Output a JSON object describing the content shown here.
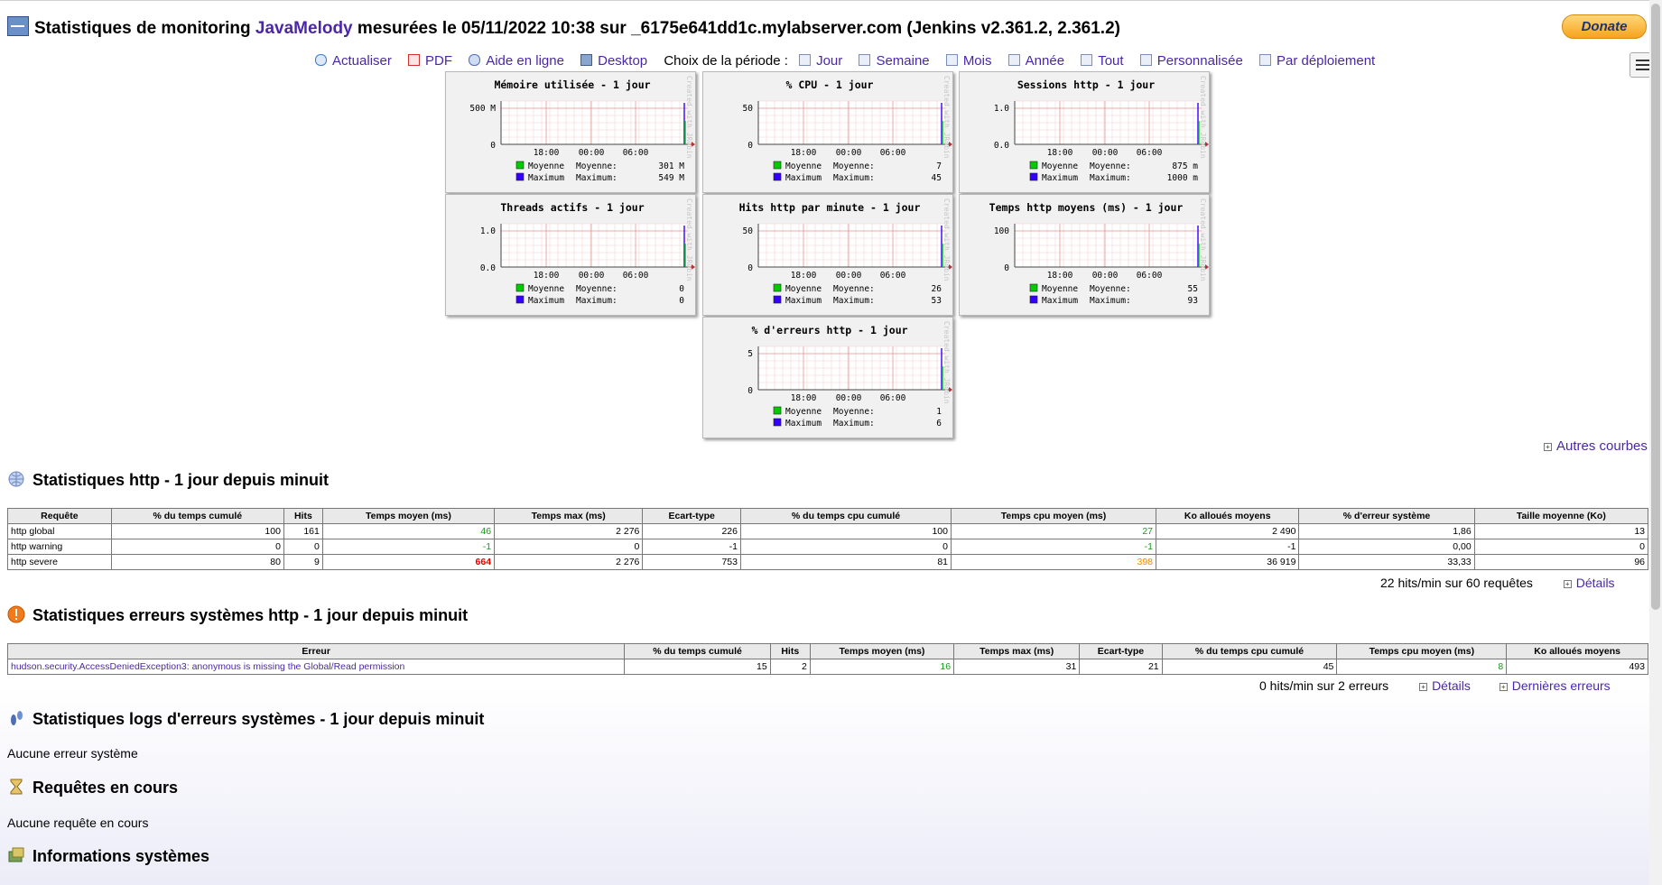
{
  "header": {
    "title_pre": "Statistiques de monitoring",
    "app_name": "JavaMelody",
    "title_post": "mesurées le 05/11/2022 10:38 sur _6175e641dd1c.mylabserver.com (Jenkins v2.361.2, 2.361.2)",
    "donate_label": "Donate"
  },
  "toolbar": {
    "refresh": "Actualiser",
    "pdf": "PDF",
    "help": "Aide en ligne",
    "desktop": "Desktop",
    "period_label": "Choix de la période :",
    "day": "Jour",
    "week": "Semaine",
    "month": "Mois",
    "year": "Année",
    "all": "Tout",
    "custom": "Personnalisée",
    "deploy": "Par déploiement"
  },
  "charts": [
    {
      "title": "Mémoire utilisée - 1 jour",
      "yticks": [
        "500 M",
        "0"
      ],
      "avg": "301 M",
      "max": "549 M"
    },
    {
      "title": "% CPU - 1 jour",
      "yticks": [
        "50",
        "0"
      ],
      "avg": "7",
      "max": "45"
    },
    {
      "title": "Sessions http - 1 jour",
      "yticks": [
        "1.0",
        "0.0"
      ],
      "avg": "875 m",
      "max": "1000 m"
    },
    {
      "title": "Threads actifs - 1 jour",
      "yticks": [
        "1.0",
        "0.0"
      ],
      "avg": "0",
      "max": "0"
    },
    {
      "title": "Hits http par minute - 1 jour",
      "yticks": [
        "50",
        "0"
      ],
      "avg": "26",
      "max": "53"
    },
    {
      "title": "Temps http moyens (ms) - 1 jour",
      "yticks": [
        "100",
        "0"
      ],
      "avg": "55",
      "max": "93"
    },
    {
      "title": "% d'erreurs http - 1 jour",
      "yticks": [
        "5",
        "0"
      ],
      "avg": "1",
      "max": "6"
    }
  ],
  "chart_common": {
    "xticks": [
      "18:00",
      "00:00",
      "06:00"
    ],
    "legend_avg": "Moyenne",
    "legend_max": "Maximum",
    "avg_label": "Moyenne:",
    "max_label": "Maximum:",
    "watermark": "Created with JRobin",
    "avg_color": "#00cc00",
    "max_color": "#3300ff"
  },
  "more_curves": "Autres courbes",
  "http_section": {
    "title": "Statistiques http - 1 jour depuis minuit",
    "headers": [
      "Requête",
      "% du temps cumulé",
      "Hits",
      "Temps moyen (ms)",
      "Temps max (ms)",
      "Ecart-type",
      "% du temps cpu cumulé",
      "Temps cpu moyen (ms)",
      "Ko alloués moyens",
      "% d'erreur système",
      "Taille moyenne (Ko)"
    ],
    "rows": [
      [
        "http global",
        "100",
        "161",
        "46",
        "2 276",
        "226",
        "100",
        "27",
        "2 490",
        "1,86",
        "13"
      ],
      [
        "http warning",
        "0",
        "0",
        "-1",
        "0",
        "-1",
        "0",
        "-1",
        "-1",
        "0,00",
        "0"
      ],
      [
        "http severe",
        "80",
        "9",
        "664",
        "2 276",
        "753",
        "81",
        "398",
        "36 919",
        "33,33",
        "96"
      ]
    ],
    "summary": "22 hits/min sur 60 requêtes",
    "details": "Détails"
  },
  "errors_section": {
    "title": "Statistiques erreurs systèmes http - 1 jour depuis minuit",
    "headers": [
      "Erreur",
      "% du temps cumulé",
      "Hits",
      "Temps moyen (ms)",
      "Temps max (ms)",
      "Ecart-type",
      "% du temps cpu cumulé",
      "Temps cpu moyen (ms)",
      "Ko alloués moyens"
    ],
    "rows": [
      [
        "hudson.security.AccessDeniedException3: anonymous is missing the Global/Read permission",
        "15",
        "2",
        "16",
        "31",
        "21",
        "45",
        "8",
        "493"
      ]
    ],
    "summary": "0 hits/min sur 2 erreurs",
    "details": "Détails",
    "last_errors": "Dernières erreurs"
  },
  "logs_section": {
    "title": "Statistiques logs d'erreurs systèmes - 1 jour depuis minuit",
    "empty": "Aucune erreur système"
  },
  "requests_section": {
    "title": "Requêtes en cours",
    "empty": "Aucune requête en cours"
  },
  "system_section": {
    "title": "Informations systèmes"
  }
}
